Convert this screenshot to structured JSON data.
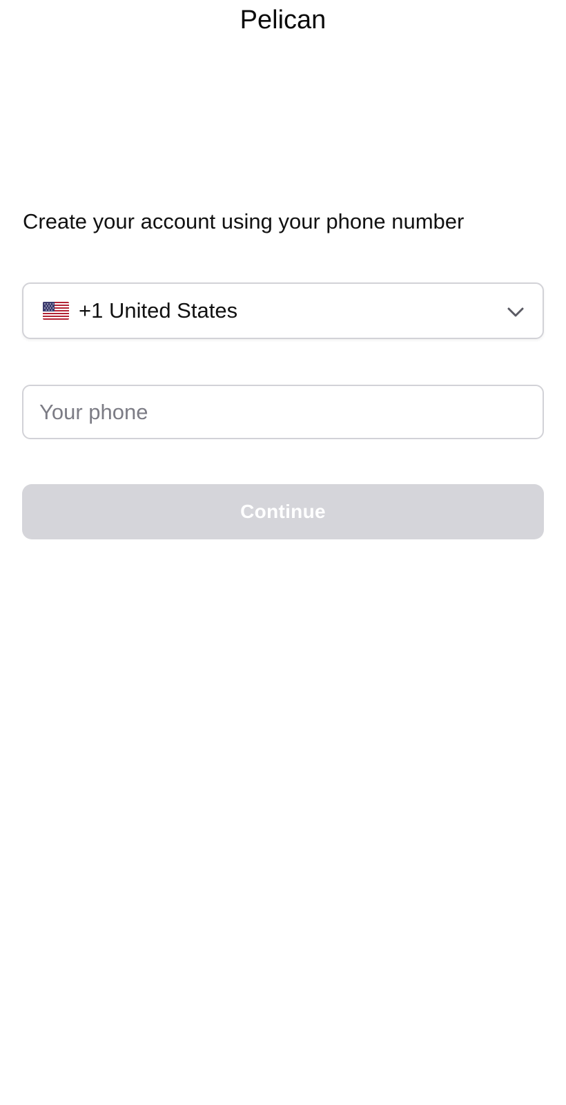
{
  "app": {
    "title": "Pelican"
  },
  "signup": {
    "instruction": "Create your account using your phone number",
    "country": {
      "flag_icon": "us-flag-icon",
      "label": "+1 United States",
      "chevron_icon": "chevron-down-icon"
    },
    "phone": {
      "value": "",
      "placeholder": "Your phone"
    },
    "continue_label": "Continue"
  },
  "colors": {
    "button_disabled_bg": "#d5d5da",
    "border": "#d2d2d7",
    "placeholder": "#7c7c85"
  }
}
